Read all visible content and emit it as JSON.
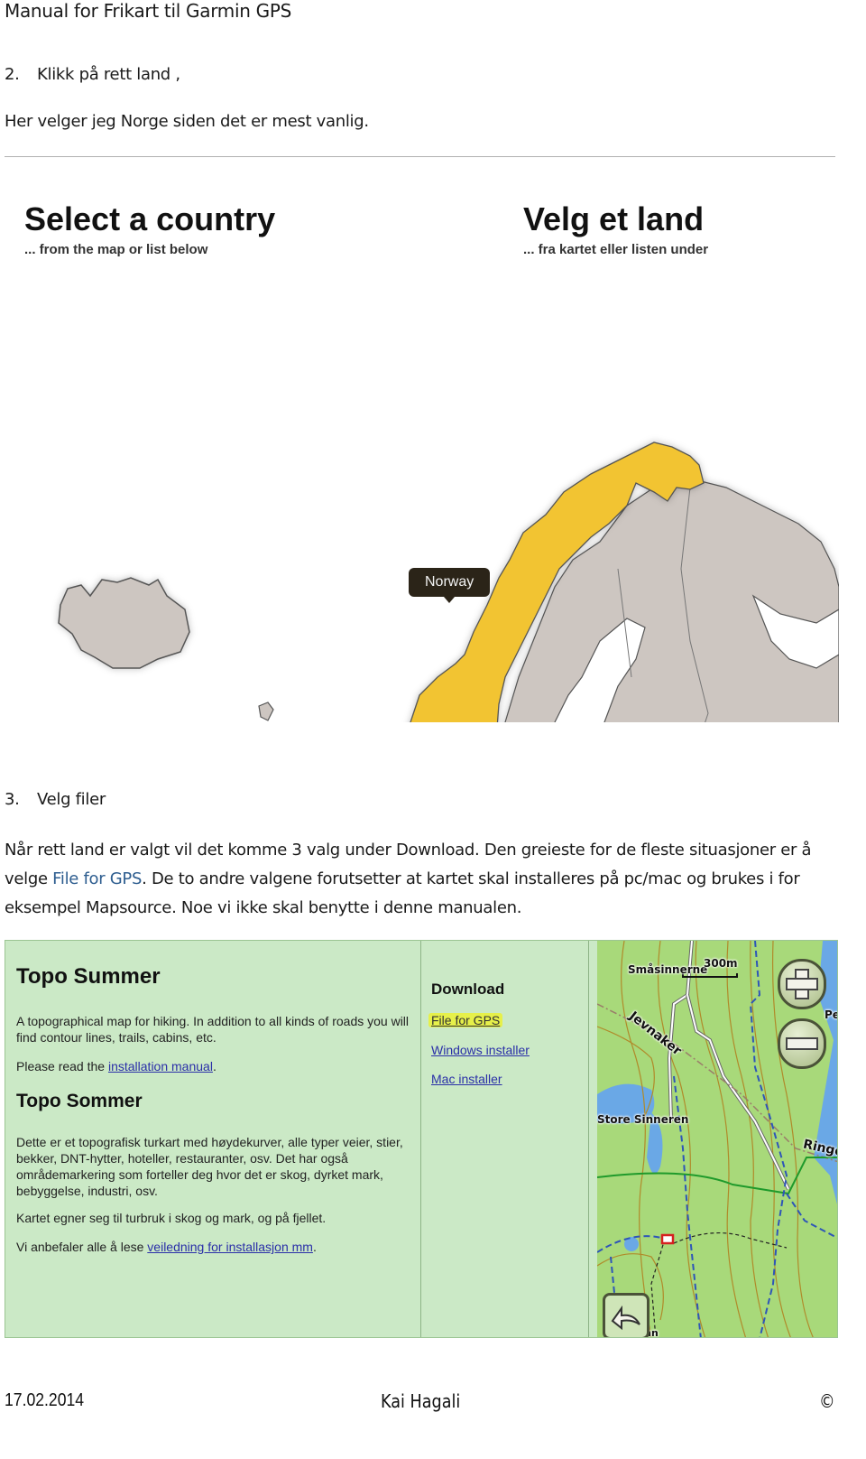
{
  "header": {
    "title": "Manual for Frikart til Garmin GPS"
  },
  "step2": {
    "number": "2.",
    "label": "Klikk på rett land ,",
    "description": "Her velger jeg Norge siden det er mest vanlig."
  },
  "country_screenshot": {
    "title_en": "Select a country",
    "subtitle_en": "... from the map or list below",
    "title_no": "Velg et land",
    "subtitle_no": "... fra kartet eller listen under",
    "tooltip": "Norway",
    "colors": {
      "selected": "#f2c430",
      "land": "#cdc6c1",
      "border": "#555555",
      "water": "#ffffff"
    }
  },
  "step3": {
    "number": "3.",
    "label": "Velg filer",
    "paragraph_before": "Når rett land er valgt vil det komme 3 valg under Download. Den greieste for de fleste situasjoner er å velge ",
    "paragraph_link": "File for GPS",
    "paragraph_after": ".  De to andre valgene forutsetter at kartet skal installeres på pc/mac og brukes i for eksempel Mapsource. Noe vi ikke skal benytte i denne manualen."
  },
  "topo_screenshot": {
    "title_en": "Topo Summer",
    "desc_en": "A topographical map for hiking. In addition to all kinds of roads you will find contour lines, trails, cabins, etc.",
    "read_prefix": "Please read the ",
    "read_link": "installation manual",
    "read_suffix": ".",
    "title_no": "Topo Sommer",
    "desc_no": "Dette er et topografisk turkart med høydekurver, alle typer veier, stier, bekker, DNT-hytter, hoteller, restauranter, osv. Det har også områdemarkering som forteller deg hvor det er skog, dyrket mark, bebyggelse, industri, osv.",
    "suitability": "Kartet egner seg til turbruk i skog og mark, og på fjellet.",
    "recommend_prefix": "Vi anbefaler alle å lese ",
    "recommend_link": "veiledning for installasjon mm",
    "recommend_suffix": ".",
    "download": {
      "title": "Download",
      "links": [
        "File for GPS",
        "Windows installer",
        "Mac installer"
      ],
      "highlight_color": "#e6f04a"
    },
    "map": {
      "labels": [
        "Småsinnerne",
        "300m",
        "Jevnaker",
        "Store Sinneren",
        "Ringe",
        "Per",
        "Ørretienn"
      ],
      "controls": {
        "zoom_in": "zoom-in",
        "zoom_out": "zoom-out",
        "back": "back-arrow"
      }
    }
  },
  "footer": {
    "date": "17.02.2014",
    "author": "Kai Hagali",
    "copyright": "©"
  }
}
